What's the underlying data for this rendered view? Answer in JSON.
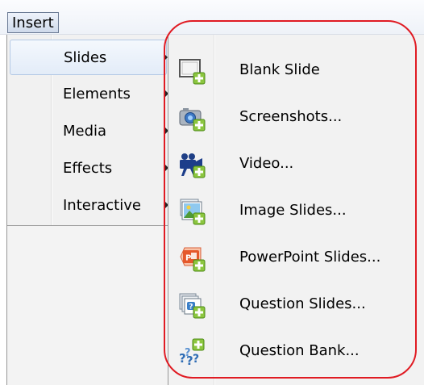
{
  "menubar": {
    "insert_label": "Insert"
  },
  "dropdown": {
    "items": [
      {
        "label": "Slides",
        "active": true
      },
      {
        "label": "Elements",
        "active": false
      },
      {
        "label": "Media",
        "active": false
      },
      {
        "label": "Effects",
        "active": false
      },
      {
        "label": "Interactive",
        "active": false
      }
    ]
  },
  "submenu": {
    "items": [
      {
        "label": "Blank Slide",
        "icon": "blank-slide-icon"
      },
      {
        "label": "Screenshots...",
        "icon": "camera-icon"
      },
      {
        "label": "Video...",
        "icon": "video-camera-icon"
      },
      {
        "label": "Image Slides...",
        "icon": "image-slide-icon"
      },
      {
        "label": "PowerPoint Slides...",
        "icon": "powerpoint-icon"
      },
      {
        "label": "Question Slides...",
        "icon": "question-slides-icon"
      },
      {
        "label": "Question Bank...",
        "icon": "question-bank-icon"
      }
    ]
  },
  "colors": {
    "highlight": "#e01b23",
    "add_badge": "#8cc63f",
    "active_item_bg": "#e3ecf8"
  }
}
